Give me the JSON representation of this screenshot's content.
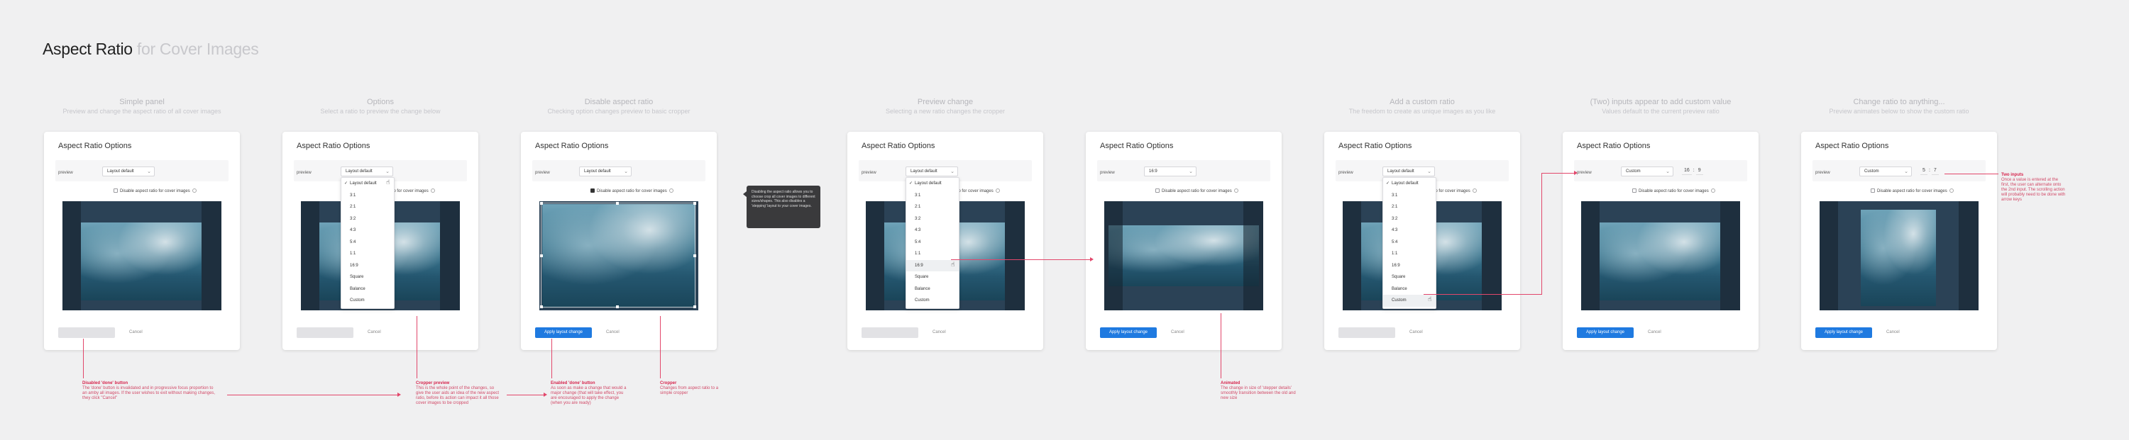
{
  "page": {
    "title": "Aspect Ratio",
    "subtitle": "for Cover Images"
  },
  "common": {
    "panel_title": "Aspect Ratio Options",
    "preview_label": "preview",
    "checkbox_label": "Disable aspect ratio for cover images",
    "apply_label": "Apply layout change",
    "cancel_label": "Cancel"
  },
  "ratio_options": [
    "Layout default",
    "3:1",
    "2:1",
    "3:2",
    "4:3",
    "5:4",
    "1:1",
    "16:9",
    "Square",
    "Balance",
    "Custom"
  ],
  "steps": [
    {
      "title": "Simple panel",
      "desc": "Preview and change the aspect ratio of all cover images",
      "select_value": "Layout default"
    },
    {
      "title": "Options",
      "desc": "Select a ratio to preview the change below",
      "select_value": "Layout default"
    },
    {
      "title": "Disable aspect ratio",
      "desc": "Checking option changes preview to basic cropper",
      "select_value": "Layout default"
    },
    {
      "title": "Preview change",
      "desc": "Selecting a new ratio changes the cropper",
      "select_value": "Layout default"
    },
    {
      "title": "",
      "desc": "",
      "select_value": "16:9"
    },
    {
      "title": "Add a custom ratio",
      "desc": "The freedom to create as unique images as you like",
      "select_value": "Layout default"
    },
    {
      "title": "(Two) inputs appear to add custom value",
      "desc": "Values default to the current preview ratio",
      "select_value": "Custom",
      "custom_w": "16",
      "custom_h": "9"
    },
    {
      "title": "Change ratio to anything...",
      "desc": "Preview animates below to show the custom ratio",
      "select_value": "Custom",
      "custom_w": "5",
      "custom_h": "7"
    }
  ],
  "tooltip_text": "Disabling the aspect ratio allows you to choose crop all cover images to different sizes/shapes. This also disables a 'stepping' layout to your cover images.",
  "notes": {
    "disabled_title": "Disabled 'done' button",
    "disabled_body": "The 'done' button is invalidated and in progressive focus proportion to an amby all images. If the user wishes to exit without making changes, they click \"Cancel\"",
    "cropper_title": "Cropper preview",
    "cropper_body": "This is the whole point of the changes, so give the user aids an idea of the new aspect ratio, before its action can impact it all those cover images to be cropped",
    "enabled_title": "Enabled 'done' button",
    "enabled_body": "As soon as make a change that would a major change (that will take effect, you are encouraged to apply the change (when you are ready)",
    "basic_title": "Cropper",
    "basic_body": "Changes from aspect ratio to a simple cropper",
    "animated_title": "Animated",
    "animated_body": "The change in size of 'stepper details' smoothly transition between the old and new size",
    "two_inputs_title": "Two inputs",
    "two_inputs_body": "Once a value is entered at the first, the user can alternate onto the 2nd input. The scrolling action will probably need to be done with arrow keys"
  }
}
